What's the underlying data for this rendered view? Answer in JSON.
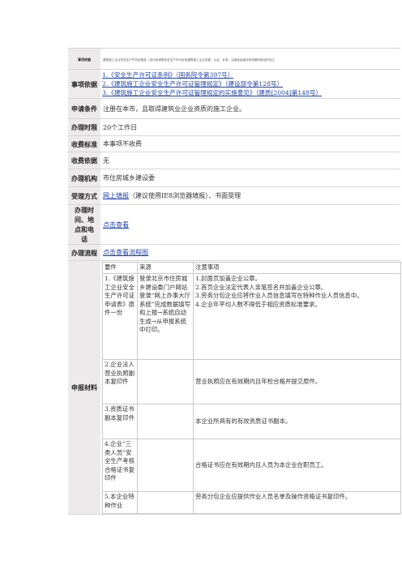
{
  "legal_basis_top": {
    "label": "事项依据",
    "text": "建筑施工企业安全生产许可证核发（含已经领取安全生产许可证的建筑施工企业变更、认证、补发、注销及延续在有效期内换证的设立"
  },
  "legal_basis": {
    "label": "事项依据",
    "items": [
      "1.《安全生产许可证条例》（国务院令第397号）",
      "2.《建筑施工企业安全生产许可证管理规定》（建设部令第128号）",
      "3.《建筑施工企业安全生产许可证管理规定的实施意见》（建质[2004]第148号）"
    ]
  },
  "conditions": {
    "label": "申请条件",
    "value": "注册在本市，且取得建筑业企业资质的施工企业。"
  },
  "time_limit": {
    "label": "办理时限",
    "value": "20个工作日"
  },
  "fee_standard": {
    "label": "收费标准",
    "value": "本事项不收费"
  },
  "fee_basis": {
    "label": "收费依据",
    "value": "无"
  },
  "agency": {
    "label": "办理机构",
    "value": "市住房城乡建设委"
  },
  "acceptance": {
    "label": "受理方式",
    "link": "网上填报",
    "rest": "（建议使用IE8浏览器填报）、书面受理"
  },
  "location": {
    "label": "办理时间、地点和电话",
    "link": "点击查看"
  },
  "process": {
    "label": "办理流程",
    "link": "点击查看流程图"
  },
  "materials": {
    "label": "申报材料",
    "headers": [
      "要件",
      "来源",
      "注意事项"
    ],
    "rows": [
      {
        "name": "1.《建筑施工企业安全生产许可证申请表》原件一份",
        "source": "登录北京市住房城乡建设委门户网站登录“网上办事大厅系统”完成数据填写和上报→系统自动生成→从申报系统中打印。",
        "notes": "1.封面页加盖企业公章。\n2.首页企业法定代表人亲笔签名并加盖企业公章。\n3.劳务分包企业应将作业人员信息填写在特种作业人员信息中。\n4.企业年平均人数不得低于相应资质标准要求。"
      },
      {
        "name": "2.企业法人营业执照副本复印件",
        "source": "",
        "notes": "营业执照应在有效期内且年检合格并提交原件。"
      },
      {
        "name": "3.资质证书副本复印件",
        "source": "",
        "notes": "本企业所具有的有效资质证书副本。"
      },
      {
        "name": "4.企业“三类人员”安全生产考核合格证书复印件",
        "source": "",
        "notes": "合格证书应在有效期内且人员为本企业在职员工。"
      },
      {
        "name": "5.本企业特种作业",
        "source": "",
        "notes": "劳务分包企业应提供作业人员名单及操作资格证书复印件。"
      }
    ]
  }
}
